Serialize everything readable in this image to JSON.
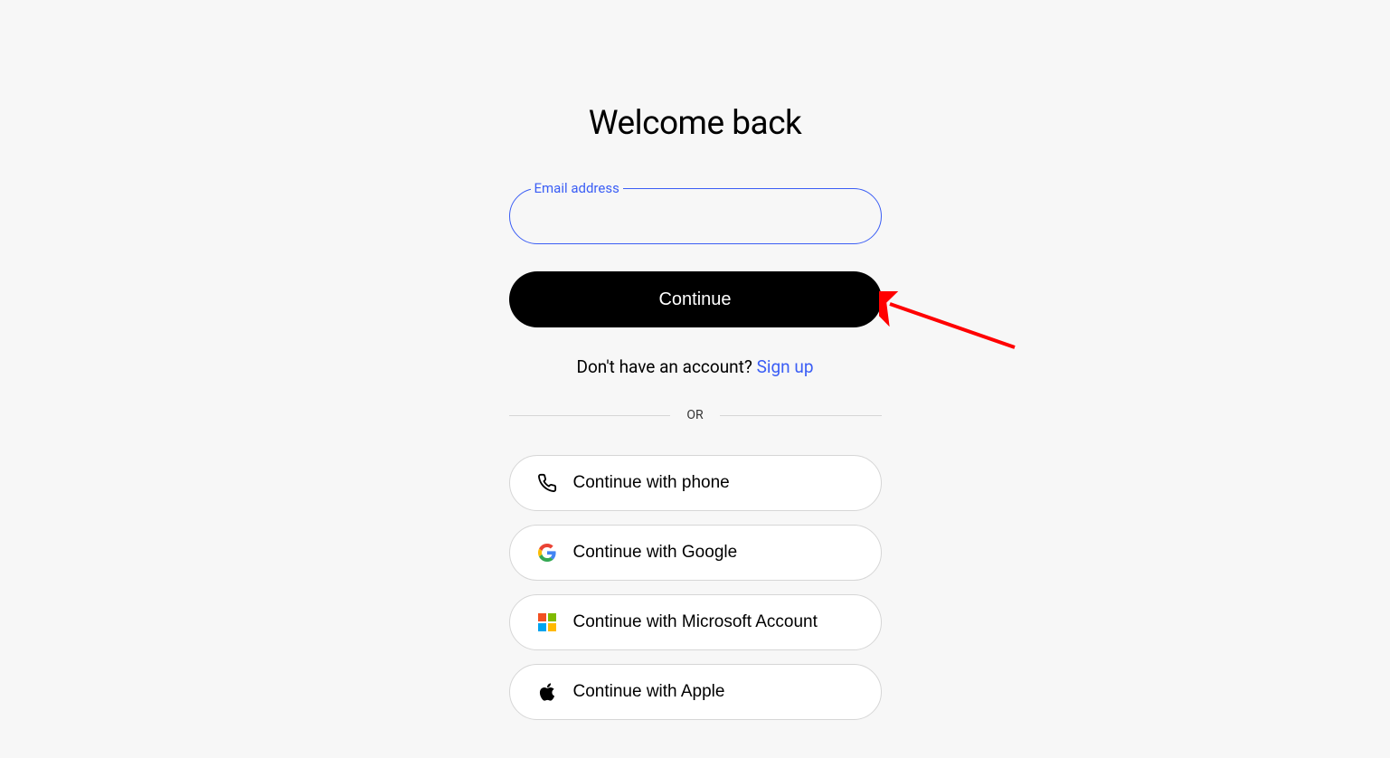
{
  "title": "Welcome back",
  "email": {
    "label": "Email address",
    "value": ""
  },
  "continue_label": "Continue",
  "signup": {
    "prompt": "Don't have an account? ",
    "link": "Sign up"
  },
  "divider_label": "OR",
  "oauth": {
    "phone": "Continue with phone",
    "google": "Continue with Google",
    "microsoft": "Continue with Microsoft Account",
    "apple": "Continue with Apple"
  }
}
